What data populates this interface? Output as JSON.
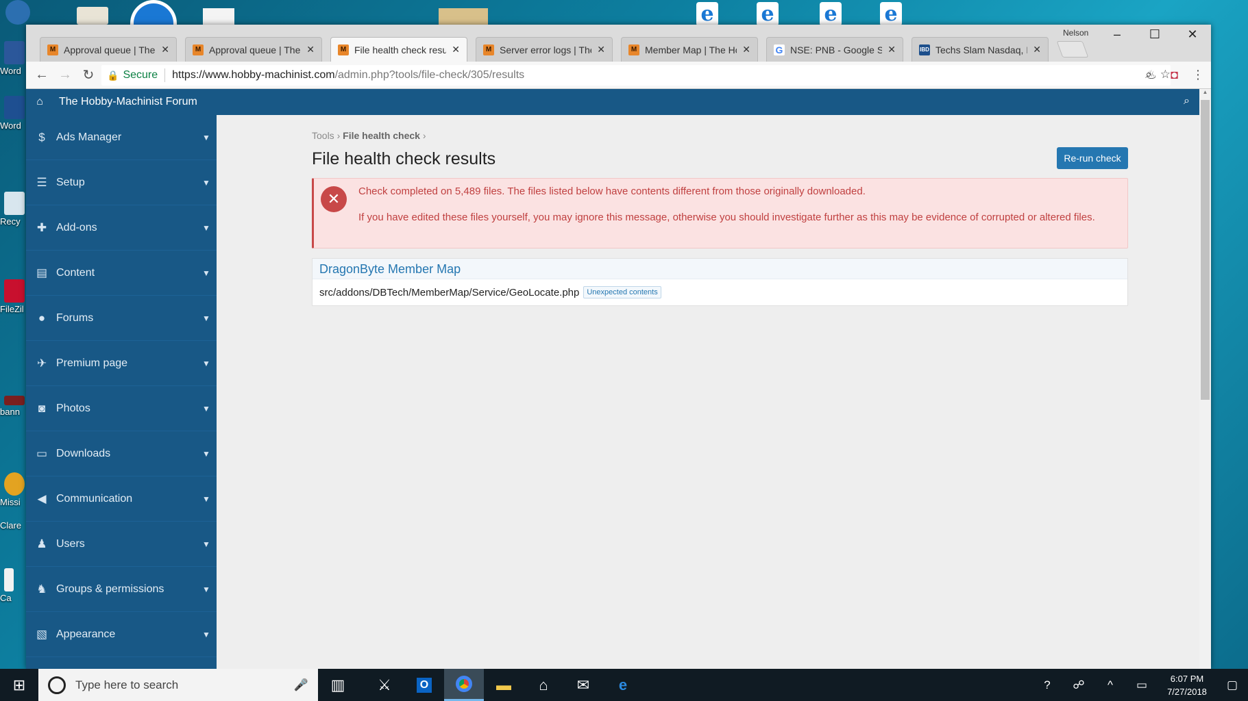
{
  "desktop": {
    "icons": [
      {
        "label": "Word"
      },
      {
        "label": "Word"
      },
      {
        "label": "Recy"
      },
      {
        "label": "FileZil"
      },
      {
        "label": "bann"
      },
      {
        "label": "Missi"
      },
      {
        "label": "Clare"
      },
      {
        "label": "Ca"
      }
    ]
  },
  "browser": {
    "profile_name": "Nelson",
    "tabs": [
      {
        "title": "Approval queue | The H",
        "favicon": "M"
      },
      {
        "title": "Approval queue | The H",
        "favicon": "M"
      },
      {
        "title": "File health check result",
        "favicon": "M"
      },
      {
        "title": "Server error logs | The",
        "favicon": "M"
      },
      {
        "title": "Member Map | The Hob",
        "favicon": "M"
      },
      {
        "title": "NSE: PNB - Google Sea",
        "favicon": "G"
      },
      {
        "title": "Techs Slam Nasdaq, Int",
        "favicon": "IBD"
      }
    ],
    "secure_label": "Secure",
    "url_host": "https://www.hobby-machinist.com",
    "url_path": "/admin.php?tools/file-check/305/results"
  },
  "header": {
    "site_title": "The Hobby-Machinist Forum"
  },
  "sidebar": {
    "items": [
      {
        "label": "Ads Manager",
        "icon": "dollar-icon"
      },
      {
        "label": "Setup",
        "icon": "sliders-icon"
      },
      {
        "label": "Add-ons",
        "icon": "puzzle-icon"
      },
      {
        "label": "Content",
        "icon": "newspaper-icon"
      },
      {
        "label": "Forums",
        "icon": "comments-icon"
      },
      {
        "label": "Premium page",
        "icon": "plane-icon"
      },
      {
        "label": "Photos",
        "icon": "camera-icon"
      },
      {
        "label": "Downloads",
        "icon": "hdd-icon"
      },
      {
        "label": "Communication",
        "icon": "bullhorn-icon"
      },
      {
        "label": "Users",
        "icon": "user-icon"
      },
      {
        "label": "Groups & permissions",
        "icon": "users-icon"
      },
      {
        "label": "Appearance",
        "icon": "image-icon"
      }
    ]
  },
  "main": {
    "breadcrumb": [
      "Tools",
      "File health check"
    ],
    "title": "File health check results",
    "rerun_label": "Re-run check",
    "alert": {
      "line1": "Check completed on 5,489 files. The files listed below have contents different from those originally downloaded.",
      "line2": "If you have edited these files yourself, you may ignore this message, otherwise you should investigate further as this may be evidence of corrupted or altered files."
    },
    "result": {
      "addon_title": "DragonByte Member Map",
      "file_path": "src/addons/DBTech/MemberMap/Service/GeoLocate.php",
      "status_badge": "Unexpected contents"
    }
  },
  "taskbar": {
    "search_placeholder": "Type here to search",
    "time": "6:07 PM",
    "date": "7/27/2018"
  },
  "colors": {
    "admin_blue": "#185886",
    "button_blue": "#2577b1",
    "error_red": "#c84848",
    "alert_bg": "#fbe2e2"
  }
}
